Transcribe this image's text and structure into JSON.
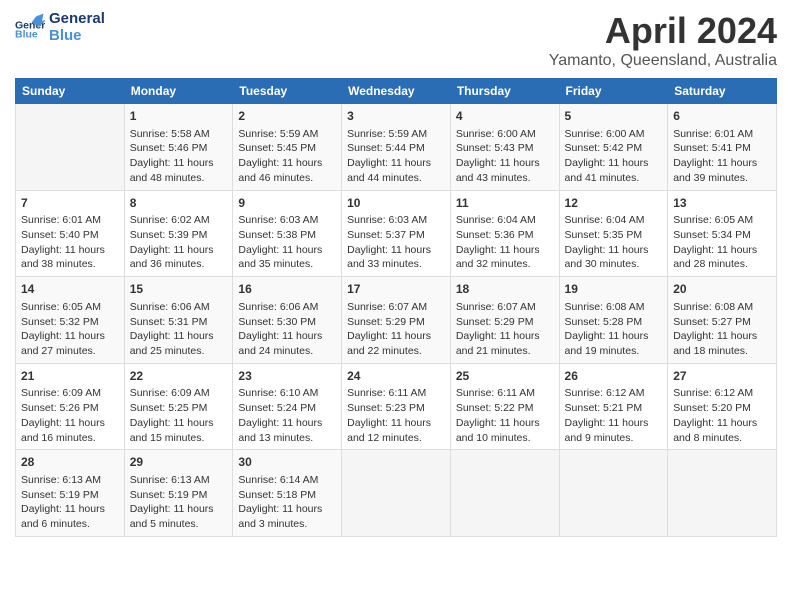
{
  "header": {
    "logo_line1": "General",
    "logo_line2": "Blue",
    "month": "April 2024",
    "location": "Yamanto, Queensland, Australia"
  },
  "weekdays": [
    "Sunday",
    "Monday",
    "Tuesday",
    "Wednesday",
    "Thursday",
    "Friday",
    "Saturday"
  ],
  "weeks": [
    [
      {
        "day": "",
        "info": ""
      },
      {
        "day": "1",
        "info": "Sunrise: 5:58 AM\nSunset: 5:46 PM\nDaylight: 11 hours\nand 48 minutes."
      },
      {
        "day": "2",
        "info": "Sunrise: 5:59 AM\nSunset: 5:45 PM\nDaylight: 11 hours\nand 46 minutes."
      },
      {
        "day": "3",
        "info": "Sunrise: 5:59 AM\nSunset: 5:44 PM\nDaylight: 11 hours\nand 44 minutes."
      },
      {
        "day": "4",
        "info": "Sunrise: 6:00 AM\nSunset: 5:43 PM\nDaylight: 11 hours\nand 43 minutes."
      },
      {
        "day": "5",
        "info": "Sunrise: 6:00 AM\nSunset: 5:42 PM\nDaylight: 11 hours\nand 41 minutes."
      },
      {
        "day": "6",
        "info": "Sunrise: 6:01 AM\nSunset: 5:41 PM\nDaylight: 11 hours\nand 39 minutes."
      }
    ],
    [
      {
        "day": "7",
        "info": "Sunrise: 6:01 AM\nSunset: 5:40 PM\nDaylight: 11 hours\nand 38 minutes."
      },
      {
        "day": "8",
        "info": "Sunrise: 6:02 AM\nSunset: 5:39 PM\nDaylight: 11 hours\nand 36 minutes."
      },
      {
        "day": "9",
        "info": "Sunrise: 6:03 AM\nSunset: 5:38 PM\nDaylight: 11 hours\nand 35 minutes."
      },
      {
        "day": "10",
        "info": "Sunrise: 6:03 AM\nSunset: 5:37 PM\nDaylight: 11 hours\nand 33 minutes."
      },
      {
        "day": "11",
        "info": "Sunrise: 6:04 AM\nSunset: 5:36 PM\nDaylight: 11 hours\nand 32 minutes."
      },
      {
        "day": "12",
        "info": "Sunrise: 6:04 AM\nSunset: 5:35 PM\nDaylight: 11 hours\nand 30 minutes."
      },
      {
        "day": "13",
        "info": "Sunrise: 6:05 AM\nSunset: 5:34 PM\nDaylight: 11 hours\nand 28 minutes."
      }
    ],
    [
      {
        "day": "14",
        "info": "Sunrise: 6:05 AM\nSunset: 5:32 PM\nDaylight: 11 hours\nand 27 minutes."
      },
      {
        "day": "15",
        "info": "Sunrise: 6:06 AM\nSunset: 5:31 PM\nDaylight: 11 hours\nand 25 minutes."
      },
      {
        "day": "16",
        "info": "Sunrise: 6:06 AM\nSunset: 5:30 PM\nDaylight: 11 hours\nand 24 minutes."
      },
      {
        "day": "17",
        "info": "Sunrise: 6:07 AM\nSunset: 5:29 PM\nDaylight: 11 hours\nand 22 minutes."
      },
      {
        "day": "18",
        "info": "Sunrise: 6:07 AM\nSunset: 5:29 PM\nDaylight: 11 hours\nand 21 minutes."
      },
      {
        "day": "19",
        "info": "Sunrise: 6:08 AM\nSunset: 5:28 PM\nDaylight: 11 hours\nand 19 minutes."
      },
      {
        "day": "20",
        "info": "Sunrise: 6:08 AM\nSunset: 5:27 PM\nDaylight: 11 hours\nand 18 minutes."
      }
    ],
    [
      {
        "day": "21",
        "info": "Sunrise: 6:09 AM\nSunset: 5:26 PM\nDaylight: 11 hours\nand 16 minutes."
      },
      {
        "day": "22",
        "info": "Sunrise: 6:09 AM\nSunset: 5:25 PM\nDaylight: 11 hours\nand 15 minutes."
      },
      {
        "day": "23",
        "info": "Sunrise: 6:10 AM\nSunset: 5:24 PM\nDaylight: 11 hours\nand 13 minutes."
      },
      {
        "day": "24",
        "info": "Sunrise: 6:11 AM\nSunset: 5:23 PM\nDaylight: 11 hours\nand 12 minutes."
      },
      {
        "day": "25",
        "info": "Sunrise: 6:11 AM\nSunset: 5:22 PM\nDaylight: 11 hours\nand 10 minutes."
      },
      {
        "day": "26",
        "info": "Sunrise: 6:12 AM\nSunset: 5:21 PM\nDaylight: 11 hours\nand 9 minutes."
      },
      {
        "day": "27",
        "info": "Sunrise: 6:12 AM\nSunset: 5:20 PM\nDaylight: 11 hours\nand 8 minutes."
      }
    ],
    [
      {
        "day": "28",
        "info": "Sunrise: 6:13 AM\nSunset: 5:19 PM\nDaylight: 11 hours\nand 6 minutes."
      },
      {
        "day": "29",
        "info": "Sunrise: 6:13 AM\nSunset: 5:19 PM\nDaylight: 11 hours\nand 5 minutes."
      },
      {
        "day": "30",
        "info": "Sunrise: 6:14 AM\nSunset: 5:18 PM\nDaylight: 11 hours\nand 3 minutes."
      },
      {
        "day": "",
        "info": ""
      },
      {
        "day": "",
        "info": ""
      },
      {
        "day": "",
        "info": ""
      },
      {
        "day": "",
        "info": ""
      }
    ]
  ]
}
